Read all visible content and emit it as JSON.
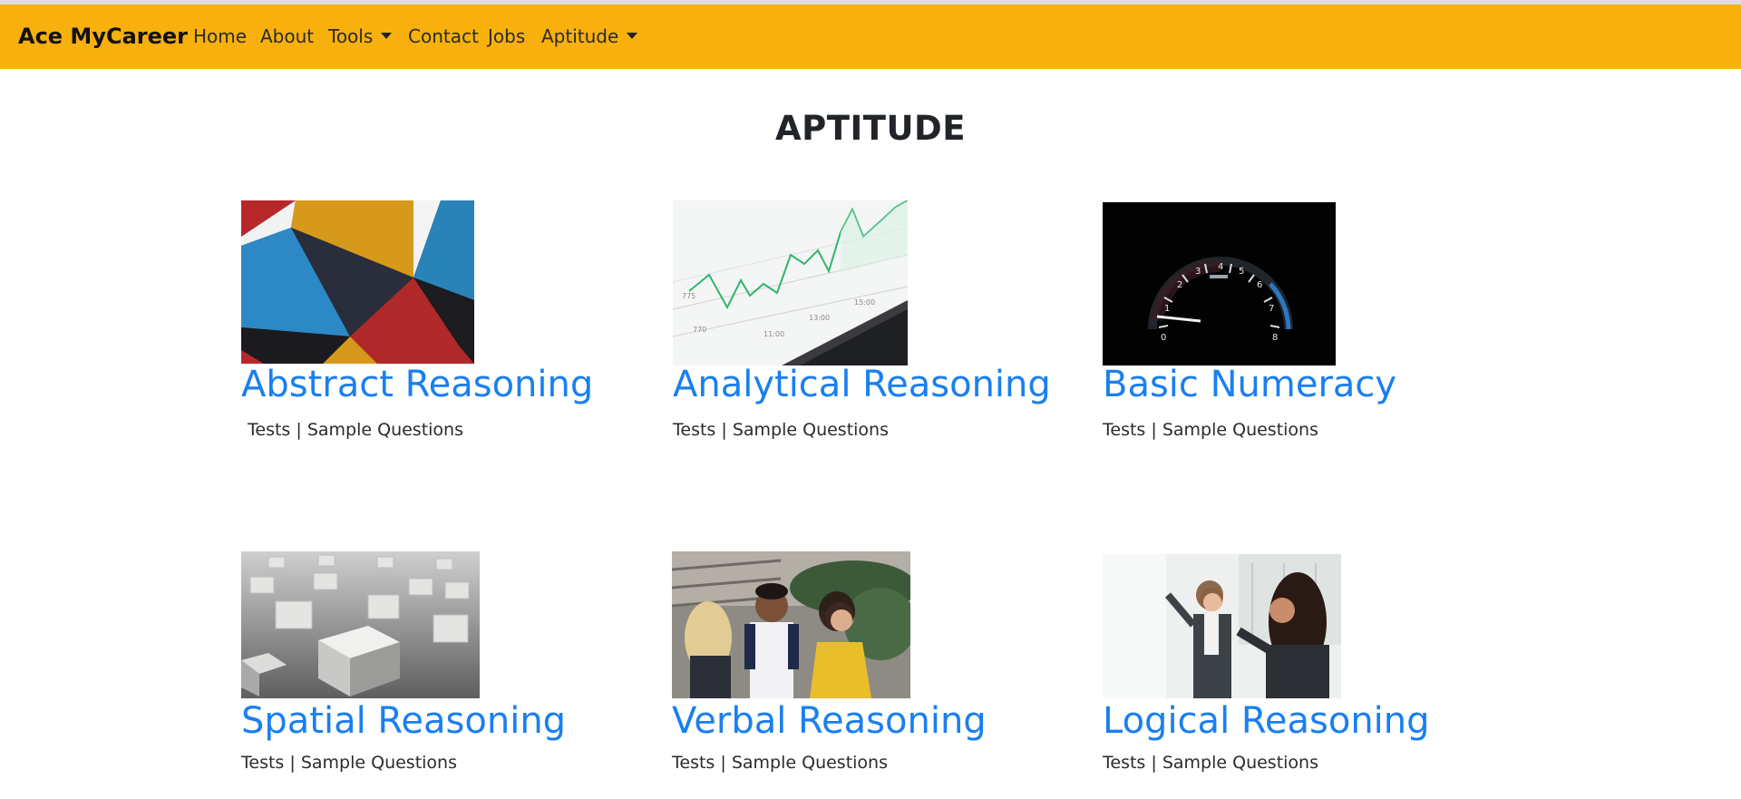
{
  "navbar": {
    "brand": "Ace MyCareer",
    "items": [
      {
        "label": "Home",
        "dropdown": false
      },
      {
        "label": "About",
        "dropdown": false
      },
      {
        "label": "Tools",
        "dropdown": true
      },
      {
        "label": "Contact",
        "dropdown": false
      },
      {
        "label": "Jobs",
        "dropdown": false
      },
      {
        "label": "Aptitude",
        "dropdown": true
      }
    ],
    "color": "#f8b00c"
  },
  "page": {
    "title": "APTITUDE"
  },
  "cards": [
    {
      "title": "Abstract Reasoning",
      "tests_label": "Tests",
      "separator": "|",
      "samples_label": "Sample Questions",
      "image": "abstract-geometric-photo"
    },
    {
      "title": "Analytical Reasoning",
      "tests_label": "Tests",
      "separator": "|",
      "samples_label": "Sample Questions",
      "image": "line-chart-laptop-photo"
    },
    {
      "title": "Basic Numeracy",
      "tests_label": "Tests",
      "separator": "|",
      "samples_label": "Sample Questions",
      "image": "speedometer-photo"
    },
    {
      "title": "Spatial Reasoning",
      "tests_label": "Tests",
      "separator": "|",
      "samples_label": "Sample Questions",
      "image": "concrete-cubes-photo"
    },
    {
      "title": "Verbal Reasoning",
      "tests_label": "Tests",
      "separator": "|",
      "samples_label": "Sample Questions",
      "image": "people-talking-photo"
    },
    {
      "title": "Logical Reasoning",
      "tests_label": "Tests",
      "separator": "|",
      "samples_label": "Sample Questions",
      "image": "whiteboard-meeting-photo"
    }
  ],
  "colors": {
    "accent": "#1a7ff0",
    "text": "#212529"
  }
}
